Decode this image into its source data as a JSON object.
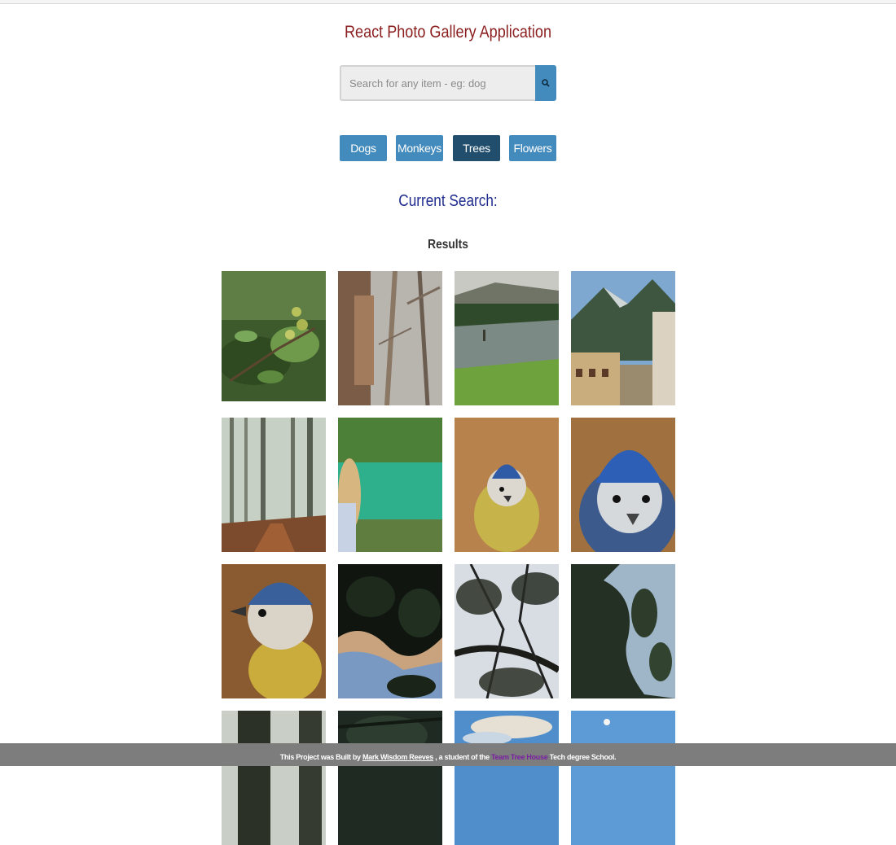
{
  "header": {
    "title": "React Photo Gallery Application"
  },
  "search": {
    "placeholder": "Search for any item - eg: dog",
    "value": "",
    "button_icon": "search-icon"
  },
  "nav": {
    "items": [
      {
        "label": "Dogs",
        "active": false
      },
      {
        "label": "Monkeys",
        "active": false
      },
      {
        "label": "Trees",
        "active": true
      },
      {
        "label": "Flowers",
        "active": false
      }
    ]
  },
  "current_search": {
    "label": "Current Search:",
    "value": ""
  },
  "results": {
    "title": "Results",
    "photos": [
      {
        "subject": "oak-branch-acorns"
      },
      {
        "subject": "eucalyptus-trunks"
      },
      {
        "subject": "river-fly-fishing"
      },
      {
        "subject": "alpine-village"
      },
      {
        "subject": "foggy-forest"
      },
      {
        "subject": "woman-at-lake"
      },
      {
        "subject": "blue-tit-bird"
      },
      {
        "subject": "blue-tit-bird-closeup"
      },
      {
        "subject": "blue-tit-portrait"
      },
      {
        "subject": "leaves-against-sky"
      },
      {
        "subject": "pine-branches"
      },
      {
        "subject": "tree-canopy"
      },
      {
        "subject": "tree-trunk"
      },
      {
        "subject": "dark-branches"
      },
      {
        "subject": "clouds-sky"
      },
      {
        "subject": "moon-blue-sky"
      }
    ]
  },
  "footer": {
    "prefix": "This Project was Built by ",
    "author": "Mark Wisdom Reeves",
    "middle": " , a student of the ",
    "school": "Team Tree House",
    "suffix": " Tech degree School."
  },
  "colors": {
    "title": "#8b1f1f",
    "accent": "#438bbd",
    "active": "#214e6c",
    "current_search": "#1f2b8f",
    "footer_bg": "#7d7d7d",
    "school_link": "#7b1fa2"
  }
}
